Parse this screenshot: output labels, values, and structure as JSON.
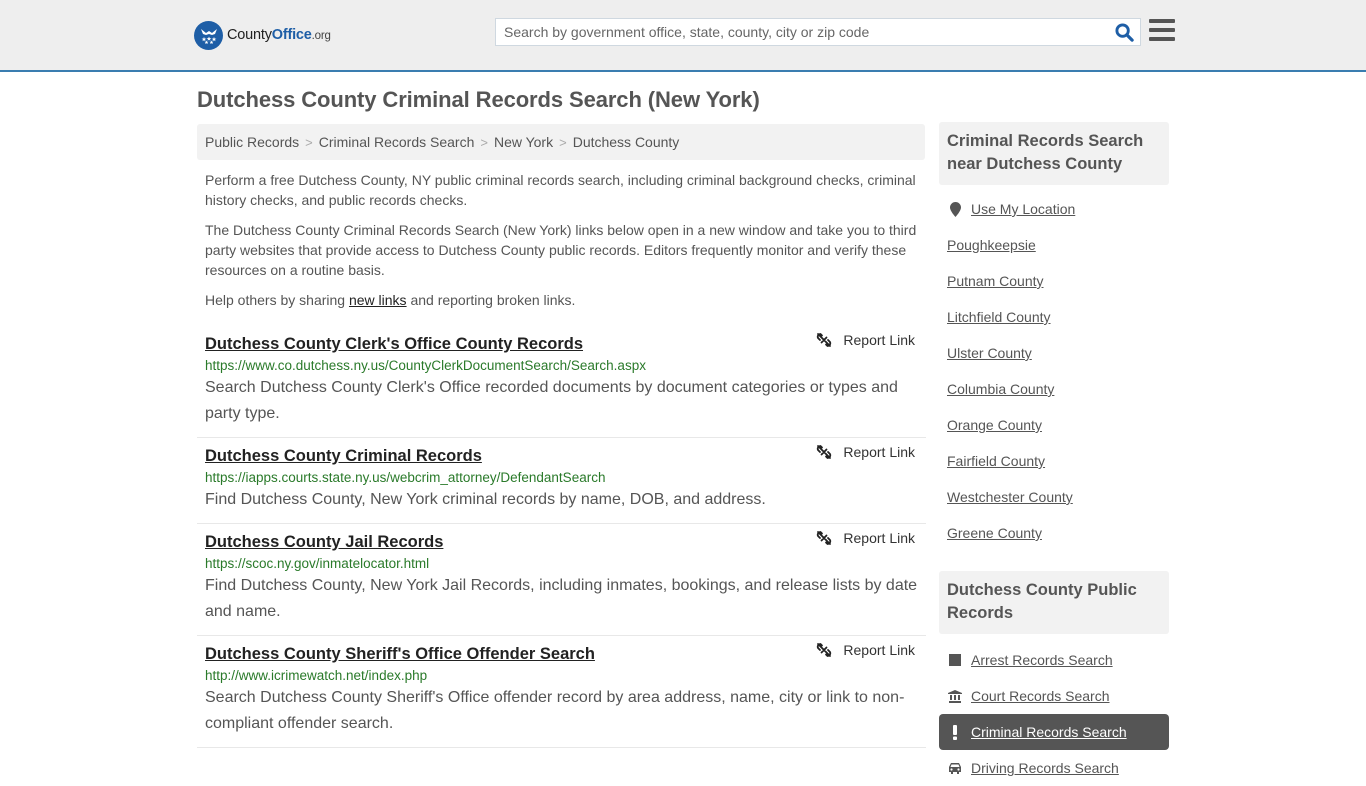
{
  "header": {
    "logo": {
      "part1": "County",
      "part2": "Office",
      "part3": ".org"
    },
    "search_placeholder": "Search by government office, state, county, city or zip code",
    "search_value": ""
  },
  "page": {
    "title": "Dutchess County Criminal Records Search (New York)"
  },
  "breadcrumb": [
    {
      "label": "Public Records"
    },
    {
      "label": "Criminal Records Search"
    },
    {
      "label": "New York"
    },
    {
      "label": "Dutchess County"
    }
  ],
  "intro": {
    "p1": "Perform a free Dutchess County, NY public criminal records search, including criminal background checks, criminal history checks, and public records checks.",
    "p2": "The Dutchess County Criminal Records Search (New York) links below open in a new window and take you to third party websites that provide access to Dutchess County public records. Editors frequently monitor and verify these resources on a routine basis.",
    "p3_before": "Help others by sharing ",
    "p3_link": "new links",
    "p3_after": " and reporting broken links."
  },
  "results": [
    {
      "title": "Dutchess County Clerk's Office County Records",
      "url": "https://www.co.dutchess.ny.us/CountyClerkDocumentSearch/Search.aspx",
      "description": "Search Dutchess County Clerk's Office recorded documents by document categories or types and party type.",
      "report_label": "Report Link"
    },
    {
      "title": "Dutchess County Criminal Records",
      "url": "https://iapps.courts.state.ny.us/webcrim_attorney/DefendantSearch",
      "description": "Find Dutchess County, New York criminal records by name, DOB, and address.",
      "report_label": "Report Link"
    },
    {
      "title": "Dutchess County Jail Records",
      "url": "https://scoc.ny.gov/inmatelocator.html",
      "description": "Find Dutchess County, New York Jail Records, including inmates, bookings, and release lists by date and name.",
      "report_label": "Report Link"
    },
    {
      "title": "Dutchess County Sheriff's Office Offender Search",
      "url": "http://www.icrimewatch.net/index.php",
      "description": "Search Dutchess County Sheriff's Office offender record by area address, name, city or link to non-compliant offender search.",
      "report_label": "Report Link"
    }
  ],
  "sidebar": {
    "nearby": {
      "heading": "Criminal Records Search near Dutchess County",
      "use_location": "Use My Location",
      "items": [
        {
          "label": "Poughkeepsie"
        },
        {
          "label": "Putnam County"
        },
        {
          "label": "Litchfield County"
        },
        {
          "label": "Ulster County"
        },
        {
          "label": "Columbia County"
        },
        {
          "label": "Orange County"
        },
        {
          "label": "Fairfield County"
        },
        {
          "label": "Westchester County"
        },
        {
          "label": "Greene County"
        }
      ]
    },
    "public_records": {
      "heading": "Dutchess County Public Records",
      "items": [
        {
          "label": "Arrest Records Search",
          "icon": "square-icon",
          "active": false
        },
        {
          "label": "Court Records Search",
          "icon": "courthouse-icon",
          "active": false
        },
        {
          "label": "Criminal Records Search",
          "icon": "exclamation-icon",
          "active": true
        },
        {
          "label": "Driving Records Search",
          "icon": "car-icon",
          "active": false
        }
      ]
    }
  },
  "colors": {
    "brand_blue": "#1e5ea6",
    "header_border": "#3a7db0",
    "url_green": "#2a7a2a",
    "active_item_bg": "#555555"
  }
}
